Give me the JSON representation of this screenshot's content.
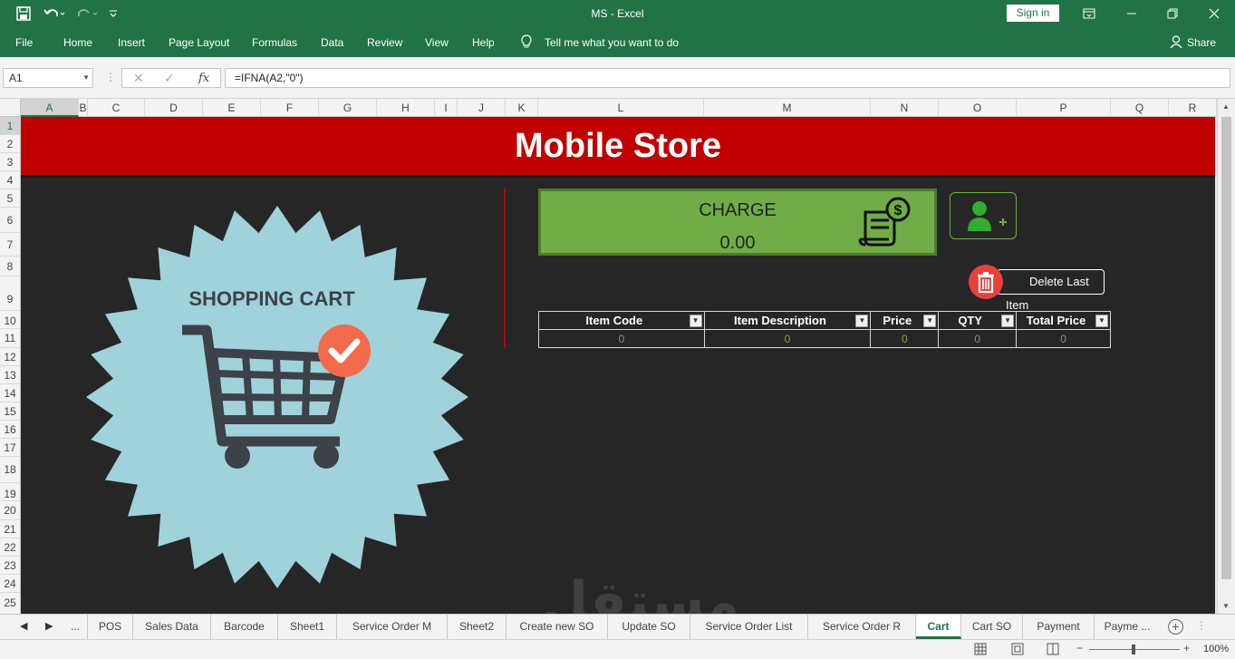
{
  "window": {
    "title": "MS  -  Excel",
    "signin_label": "Sign in",
    "share_label": "Share"
  },
  "ribbon": {
    "tabs": [
      "File",
      "Home",
      "Insert",
      "Page Layout",
      "Formulas",
      "Data",
      "Review",
      "View",
      "Help"
    ],
    "tell_me": "Tell me what you want to do"
  },
  "formula_bar": {
    "name_box": "A1",
    "formula": "=IFNA(A2,\"0\")"
  },
  "columns": [
    "A",
    "B",
    "C",
    "D",
    "E",
    "F",
    "G",
    "H",
    "I",
    "J",
    "K",
    "L",
    "M",
    "N",
    "O",
    "P",
    "Q",
    "R"
  ],
  "rows": [
    "1",
    "2",
    "3",
    "4",
    "5",
    "6",
    "7",
    "8",
    "9",
    "10",
    "11",
    "12",
    "13",
    "14",
    "15",
    "16",
    "17",
    "18",
    "19",
    "20",
    "21",
    "22",
    "23",
    "24",
    "25"
  ],
  "sheet": {
    "banner_title": "Mobile Store",
    "cart_label": "SHOPPING CART",
    "charge_label": "CHARGE",
    "charge_value": "0.00",
    "delete_label": "Delete Last Item",
    "table": {
      "headers": [
        "Item Code",
        "Item Description",
        "Price",
        "QTY",
        "Total Price"
      ],
      "rows": [
        [
          "0",
          "0",
          "0",
          "0",
          "0"
        ]
      ]
    },
    "watermark": "مستقل"
  },
  "sheet_tabs": {
    "tabs": [
      "POS",
      "Sales Data",
      "Barcode",
      "Sheet1",
      "Service Order M",
      "Sheet2",
      "Create new SO",
      "Update SO",
      "Service Order List",
      "Service Order R",
      "Cart",
      "Cart SO",
      "Payment",
      "Payme ..."
    ],
    "active": "Cart",
    "more_label": "..."
  },
  "status": {
    "zoom": "100%"
  },
  "colors": {
    "excel_green": "#217346",
    "banner_red": "#c00000",
    "sheet_bg": "#262626",
    "charge_green": "#70ad47",
    "badge_blue": "#a0d2db",
    "check_orange": "#f26b4c"
  }
}
